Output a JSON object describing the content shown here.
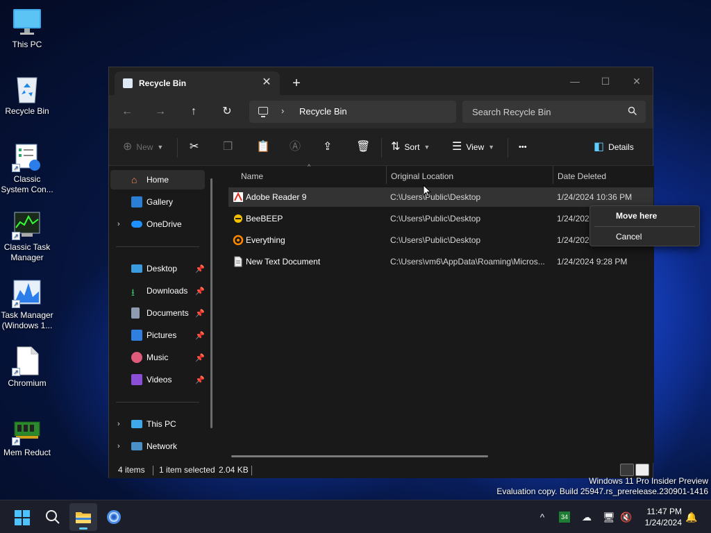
{
  "desktop": {
    "icons": [
      {
        "label": "This PC"
      },
      {
        "label": "Recycle Bin"
      },
      {
        "label": "Classic System Con..."
      },
      {
        "label": "Classic Task Manager"
      },
      {
        "label": "Task Manager (Windows 1..."
      },
      {
        "label": "Chromium"
      },
      {
        "label": "Mem Reduct"
      }
    ],
    "watermark": {
      "line1": "Windows 11 Pro Insider Preview",
      "line2": "Evaluation copy. Build 25947.rs_prerelease.230901-1416"
    }
  },
  "window": {
    "tab_title": "Recycle Bin",
    "tab_close": "✕",
    "new_tab": "+",
    "caption": {
      "minimize": "—",
      "maximize": "☐",
      "close": "✕"
    },
    "nav": {
      "back": "←",
      "forward": "→",
      "up": "↑",
      "refresh": "↻"
    },
    "address_path": "Recycle Bin",
    "address_chevron": "›",
    "search_placeholder": "Search Recycle Bin",
    "commands": {
      "new": "New",
      "sort": "Sort",
      "view": "View",
      "more": "•••",
      "details": "Details"
    },
    "sidebar": {
      "items": [
        {
          "label": "Home"
        },
        {
          "label": "Gallery"
        },
        {
          "label": "OneDrive"
        },
        {
          "label": "Desktop"
        },
        {
          "label": "Downloads"
        },
        {
          "label": "Documents"
        },
        {
          "label": "Pictures"
        },
        {
          "label": "Music"
        },
        {
          "label": "Videos"
        },
        {
          "label": "This PC"
        },
        {
          "label": "Network"
        }
      ]
    },
    "columns": {
      "name": "Name",
      "original_location": "Original Location",
      "date_deleted": "Date Deleted"
    },
    "rows": [
      {
        "name": "Adobe Reader 9",
        "location": "C:\\Users\\Public\\Desktop",
        "date": "1/24/2024 10:36 PM"
      },
      {
        "name": "BeeBEEP",
        "location": "C:\\Users\\Public\\Desktop",
        "date": "1/24/2024"
      },
      {
        "name": "Everything",
        "location": "C:\\Users\\Public\\Desktop",
        "date": "1/24/2024"
      },
      {
        "name": "New Text Document",
        "location": "C:\\Users\\vm6\\AppData\\Roaming\\Micros...",
        "date": "1/24/2024 9:28 PM"
      }
    ],
    "status": {
      "count": "4 items",
      "selection": "1 item selected",
      "size": "2.04 KB"
    }
  },
  "context_menu": {
    "items": [
      {
        "label": "Move here"
      },
      {
        "label": "Cancel"
      }
    ]
  },
  "taskbar": {
    "clock_time": "11:47 PM",
    "clock_date": "1/24/2024",
    "tray_badge": "34"
  },
  "colors": {
    "accent": "#60cdff",
    "window_bg": "#191919",
    "selection": "#333333"
  }
}
